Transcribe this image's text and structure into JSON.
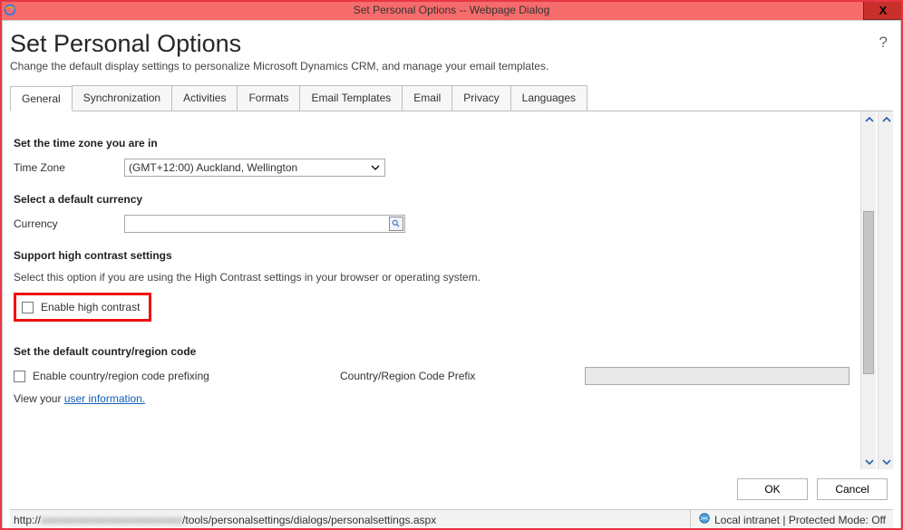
{
  "window": {
    "title": "Set Personal Options -- Webpage Dialog",
    "close_label": "X"
  },
  "header": {
    "title": "Set Personal Options",
    "subtitle": "Change the default display settings to personalize Microsoft Dynamics CRM, and manage your email templates.",
    "help": "?"
  },
  "tabs": [
    "General",
    "Synchronization",
    "Activities",
    "Formats",
    "Email Templates",
    "Email",
    "Privacy",
    "Languages"
  ],
  "active_tab": "General",
  "sections": {
    "timezone": {
      "title": "Set the time zone you are in",
      "label": "Time Zone",
      "value": "(GMT+12:00) Auckland, Wellington"
    },
    "currency": {
      "title": "Select a default currency",
      "label": "Currency",
      "value": ""
    },
    "contrast": {
      "title": "Support high contrast settings",
      "desc": "Select this option if you are using the High Contrast settings in your browser or operating system.",
      "checkbox_label": "Enable high contrast",
      "checked": false
    },
    "region": {
      "title": "Set the default country/region code",
      "checkbox_label": "Enable country/region code prefixing",
      "checked": false,
      "prefix_label": "Country/Region Code Prefix",
      "prefix_value": ""
    },
    "userinfo": {
      "prefix": "View your ",
      "link": "user information."
    }
  },
  "footer": {
    "ok": "OK",
    "cancel": "Cancel"
  },
  "statusbar": {
    "url_prefix": "http://",
    "url_suffix": "/tools/personalsettings/dialogs/personalsettings.aspx",
    "zone": "Local intranet | Protected Mode: Off"
  }
}
